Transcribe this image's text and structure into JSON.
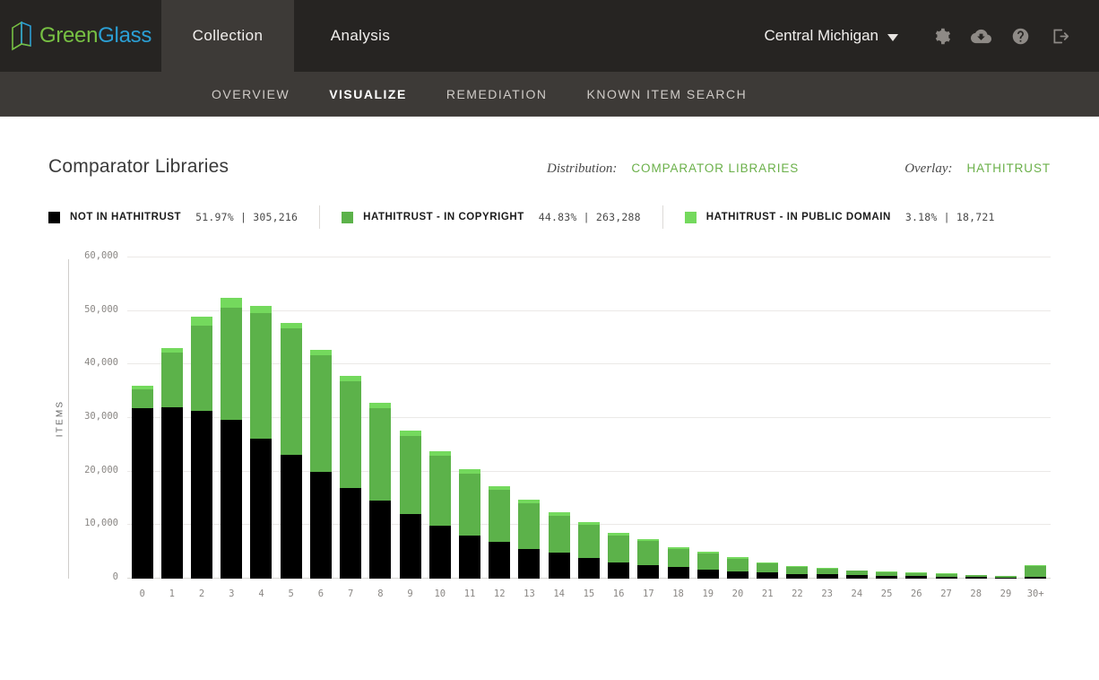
{
  "header": {
    "brand": {
      "part1": "Green",
      "part2": "Glass",
      "logo_icon": "book-logo-icon"
    },
    "tabs": [
      {
        "label": "Collection",
        "active": true
      },
      {
        "label": "Analysis",
        "active": false
      }
    ],
    "org": "Central Michigan",
    "icons": [
      "gear-icon",
      "cloud-download-icon",
      "help-icon",
      "logout-icon"
    ]
  },
  "subnav": [
    {
      "label": "OVERVIEW",
      "active": false
    },
    {
      "label": "VISUALIZE",
      "active": true
    },
    {
      "label": "REMEDIATION",
      "active": false
    },
    {
      "label": "KNOWN ITEM SEARCH",
      "active": false
    }
  ],
  "page": {
    "title": "Comparator Libraries",
    "distribution_label": "Distribution:",
    "distribution_value": "COMPARATOR LIBRARIES",
    "overlay_label": "Overlay:",
    "overlay_value": "HATHITRUST"
  },
  "legend": [
    {
      "name": "NOT IN HATHITRUST",
      "percent": "51.97%",
      "sep": "|",
      "count": "305,216",
      "color": "#000000"
    },
    {
      "name": "HATHITRUST - IN COPYRIGHT",
      "percent": "44.83%",
      "sep": "|",
      "count": "263,288",
      "color": "#5cb24a"
    },
    {
      "name": "HATHITRUST - IN PUBLIC DOMAIN",
      "percent": "3.18%",
      "sep": "|",
      "count": "18,721",
      "color": "#74d95d"
    }
  ],
  "chart_data": {
    "type": "bar",
    "stacked": true,
    "title": "Comparator Libraries",
    "xlabel": "",
    "ylabel": "ITEMS",
    "ylim": [
      0,
      60000
    ],
    "yticks": [
      0,
      10000,
      20000,
      30000,
      40000,
      50000,
      60000
    ],
    "ytick_labels": [
      "0",
      "10,000",
      "20,000",
      "30,000",
      "40,000",
      "50,000",
      "60,000"
    ],
    "grid": true,
    "legend_position": "top",
    "categories": [
      "0",
      "1",
      "2",
      "3",
      "4",
      "5",
      "6",
      "7",
      "8",
      "9",
      "10",
      "11",
      "12",
      "13",
      "14",
      "15",
      "16",
      "17",
      "18",
      "19",
      "20",
      "21",
      "22",
      "23",
      "24",
      "25",
      "26",
      "27",
      "28",
      "29",
      "30+"
    ],
    "series": [
      {
        "name": "NOT IN HATHITRUST",
        "color": "#000000",
        "values": [
          31800,
          32000,
          31300,
          29700,
          26200,
          23200,
          20000,
          17000,
          14500,
          12100,
          9900,
          8100,
          6800,
          5600,
          4800,
          3900,
          3100,
          2600,
          2100,
          1700,
          1400,
          1200,
          900,
          800,
          650,
          550,
          450,
          400,
          300,
          250,
          300
        ]
      },
      {
        "name": "HATHITRUST - IN COPYRIGHT",
        "color": "#5cb24a",
        "values": [
          3600,
          10200,
          16000,
          21000,
          23400,
          23500,
          21800,
          19900,
          17400,
          14600,
          13100,
          11500,
          9800,
          8400,
          7000,
          6100,
          5000,
          4400,
          3500,
          3000,
          2300,
          1700,
          1300,
          1000,
          800,
          650,
          550,
          450,
          350,
          250,
          2100
        ]
      },
      {
        "name": "HATHITRUST - IN PUBLIC DOMAIN",
        "color": "#74d95d",
        "values": [
          700,
          900,
          1700,
          1700,
          1300,
          1100,
          1000,
          1000,
          900,
          900,
          800,
          800,
          700,
          700,
          600,
          500,
          450,
          400,
          350,
          300,
          250,
          200,
          180,
          160,
          140,
          120,
          110,
          100,
          90,
          80,
          200
        ]
      }
    ]
  }
}
